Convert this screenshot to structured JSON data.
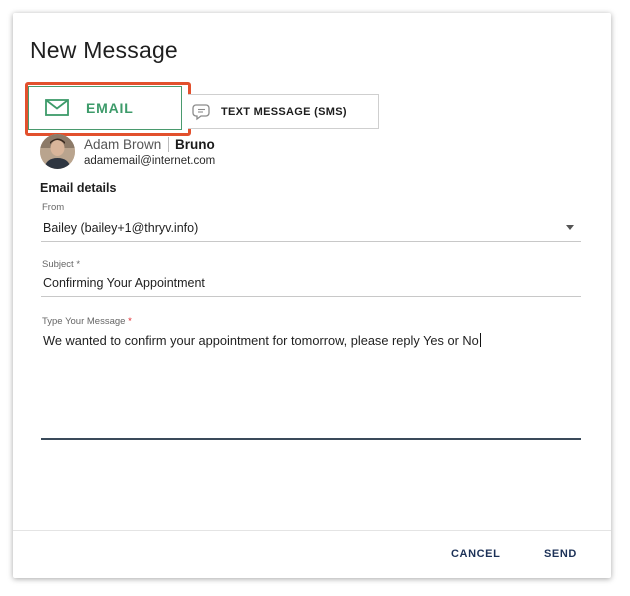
{
  "dialog": {
    "title": "New Message"
  },
  "tabs": {
    "email": {
      "label": "EMAIL",
      "icon": "envelope-icon",
      "active": true
    },
    "sms": {
      "label": "TEXT MESSAGE (SMS)",
      "icon": "chat-bubble-icon",
      "active": false
    }
  },
  "contact": {
    "name": "Adam Brown",
    "company": "Bruno",
    "email": "adamemail@internet.com",
    "avatar": "avatar"
  },
  "email_details": {
    "section_title": "Email details",
    "from": {
      "label": "From",
      "value": "Bailey (bailey+1@thryv.info)"
    },
    "subject": {
      "label": "Subject",
      "required_mark": "*",
      "value": "Confirming Your Appointment"
    },
    "message": {
      "label": "Type Your Message",
      "required_mark": "*",
      "value": "We wanted to confirm your appointment for tomorrow, please reply Yes or No"
    }
  },
  "footer": {
    "cancel_label": "CANCEL",
    "send_label": "SEND"
  },
  "colors": {
    "accent_green": "#3d9b6a",
    "highlight_red": "#e2502d",
    "button_navy": "#1c3157",
    "required_red": "#e0262b"
  }
}
